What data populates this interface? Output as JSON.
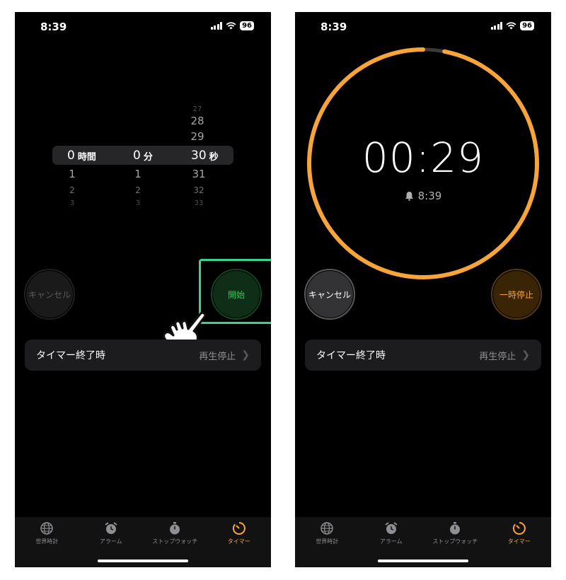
{
  "status": {
    "time": "8:39",
    "battery": "96"
  },
  "picker": {
    "hours": {
      "above": [],
      "selected": "0",
      "unit": "時間",
      "below": [
        "1",
        "2",
        "3"
      ]
    },
    "minutes": {
      "above": [],
      "selected": "0",
      "unit": "分",
      "below": [
        "1",
        "2",
        "3"
      ]
    },
    "seconds": {
      "above": [
        "27",
        "28",
        "29"
      ],
      "selected": "30",
      "unit": "秒",
      "below": [
        "31",
        "32",
        "33"
      ]
    }
  },
  "buttons": {
    "cancel": "キャンセル",
    "start": "開始",
    "pause": "一時停止"
  },
  "setting": {
    "label": "タイマー終了時",
    "value": "再生停止"
  },
  "running": {
    "remaining": "00:29",
    "end_time": "8:39",
    "progress_fraction": 0.97
  },
  "tabs": [
    {
      "label": "世界時計",
      "icon": "globe-icon",
      "active": false
    },
    {
      "label": "アラーム",
      "icon": "alarm-clock-icon",
      "active": false
    },
    {
      "label": "ストップウォッチ",
      "icon": "stopwatch-icon",
      "active": false
    },
    {
      "label": "タイマー",
      "icon": "timer-icon",
      "active": true
    }
  ],
  "colors": {
    "accent": "#f7a43a",
    "start_green": "#2ecc5a",
    "highlight": "#3fcf8e",
    "ring_track": "#3a3a3c"
  }
}
